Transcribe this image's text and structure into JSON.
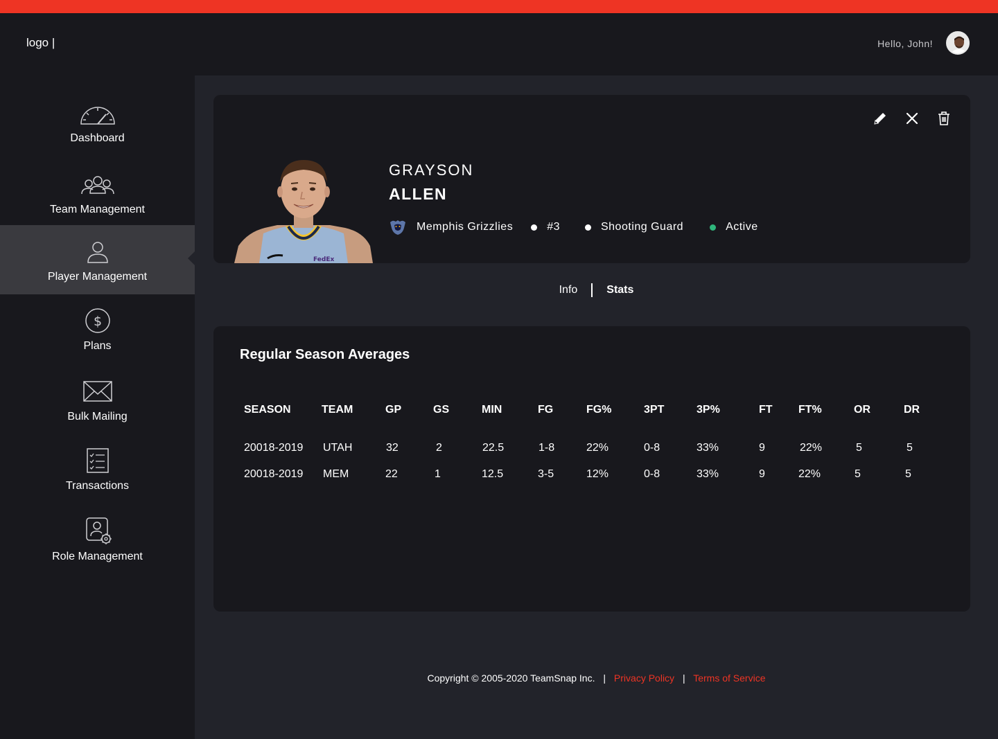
{
  "header": {
    "logo_text": "logo |",
    "greeting": "Hello, John!"
  },
  "sidebar": {
    "items": [
      {
        "label": "Dashboard",
        "icon": "speedometer-icon"
      },
      {
        "label": "Team Management",
        "icon": "team-icon"
      },
      {
        "label": "Player Management",
        "icon": "user-icon",
        "active": true
      },
      {
        "label": "Plans",
        "icon": "dollar-icon"
      },
      {
        "label": "Bulk Mailing",
        "icon": "envelope-icon"
      },
      {
        "label": "Transactions",
        "icon": "checklist-icon"
      },
      {
        "label": "Role Management",
        "icon": "user-settings-icon"
      }
    ]
  },
  "player": {
    "first_name": "GRAYSON",
    "last_name": "ALLEN",
    "team": "Memphis Grizzlies",
    "number": "#3",
    "position": "Shooting Guard",
    "status": "Active"
  },
  "tabs": {
    "info": "Info",
    "stats": "Stats",
    "active": "Stats"
  },
  "stats": {
    "title": "Regular Season Averages",
    "columns": [
      "SEASON",
      "TEAM",
      "GP",
      "GS",
      "MIN",
      "FG",
      "FG%",
      "3PT",
      "3P%",
      "FT",
      "FT%",
      "OR",
      "DR"
    ],
    "rows": [
      [
        "20018-2019",
        "UTAH",
        "32",
        "2",
        "22.5",
        "1-8",
        "22%",
        "0-8",
        "33%",
        "9",
        "22%",
        "5",
        "5"
      ],
      [
        "20018-2019",
        "MEM",
        "22",
        "1",
        "12.5",
        "3-5",
        "12%",
        "0-8",
        "33%",
        "9",
        "22%",
        "5",
        "5"
      ]
    ]
  },
  "footer": {
    "copyright": "Copyright © 2005-2020 TeamSnap Inc.",
    "separator": "|",
    "privacy": "Privacy Policy",
    "terms": "Terms of Service"
  },
  "colors": {
    "accent": "#ee3424",
    "background": "#22232a",
    "panel": "#18181d",
    "active_nav": "#3a3a3f",
    "status_active": "#2fb67c"
  }
}
